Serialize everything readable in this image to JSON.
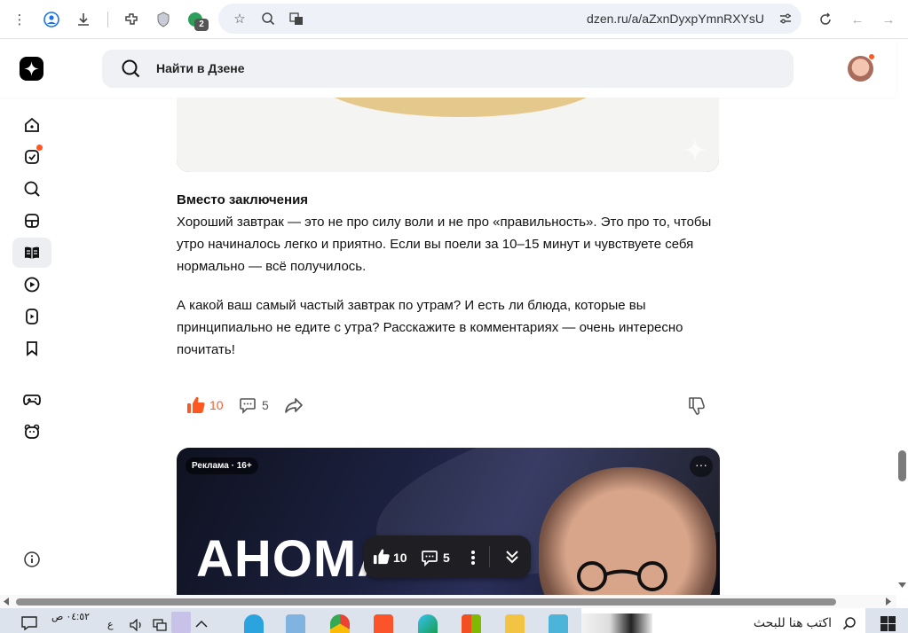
{
  "browser": {
    "url": "dzen.ru/a/aZxnDyxpYmnRXYsU",
    "extension_badge": "2"
  },
  "header": {
    "search_placeholder": "Найти в Дзене"
  },
  "sidebar": {
    "items": [
      "home-icon",
      "subscriptions-icon",
      "search-icon",
      "box-icon",
      "articles-icon",
      "video-icon",
      "shorts-icon",
      "bookmark-icon",
      "games-icon",
      "kids-icon",
      "info-icon"
    ]
  },
  "article": {
    "heading": "Вместо заключения",
    "paragraph1": "Хороший завтрак — это не про силу воли и не про «правильность». Это про то, чтобы утро начиналось легко и приятно. Если вы поели за 10–15 минут и чувствуете себя нормально — всё получилось.",
    "paragraph2": "А какой ваш самый частый завтрак по утрам? И есть ли блюда, которые вы принципиально не едите с утра? Расскажите в комментариях — очень интересно почитать!"
  },
  "reactions": {
    "likes": "10",
    "comments": "5"
  },
  "ad": {
    "label": "Реклама · 16+",
    "menu": "···",
    "title": "АНОМА"
  },
  "floating_bar": {
    "likes": "10",
    "comments": "5"
  },
  "taskbar": {
    "search_text": "اكتب هنا للبحث",
    "time": "٠٤:٥٢ ص",
    "lang": "ع"
  },
  "colors": {
    "accent": "#ff5722",
    "dark": "#1f1f23"
  }
}
